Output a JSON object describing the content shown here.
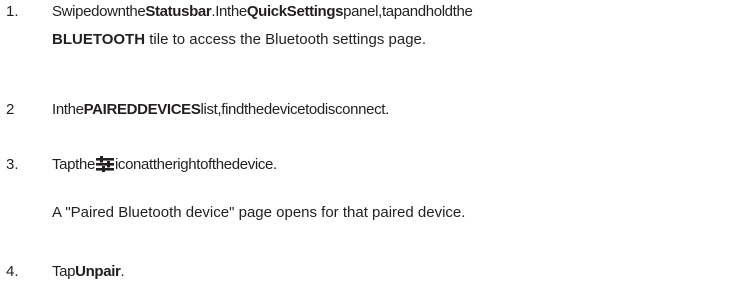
{
  "steps": [
    {
      "number": "1.",
      "line1": {
        "t1": "Swipedownthe",
        "b1": "Statusbar",
        "t2": ".Inthe",
        "b2": "QuickSettings",
        "t3": "panel,tapandholdthe"
      },
      "line2": {
        "b1": "BLUETOOTH",
        "t1": " tile to access the Bluetooth settings page."
      }
    },
    {
      "number": "2",
      "t1": "Inthe",
      "b1": "PAIREDDEVICES",
      "t2": "list,findthedevicetodisconnect."
    },
    {
      "number": "3.",
      "t1": "Tapthe",
      "icon": "settings-sliders-icon",
      "t2": "iconattherightofthedevice.",
      "note": "A \"Paired Bluetooth device\" page opens for that paired device."
    },
    {
      "number": "4.",
      "t1": "Tap",
      "b1": "Unpair",
      "t2": "."
    }
  ]
}
